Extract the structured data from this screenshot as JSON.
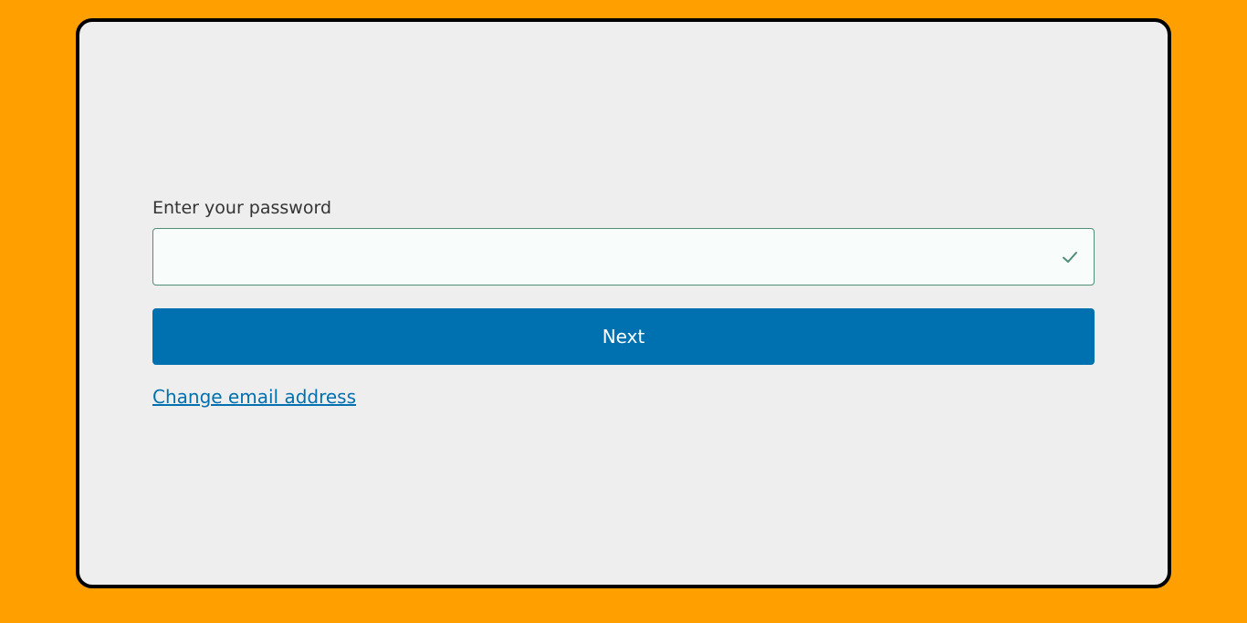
{
  "colors": {
    "page_background": "#ffa000",
    "card_background": "#eeeeee",
    "card_border": "#000000",
    "input_border_valid": "#4e8e75",
    "input_background": "#f8fcfb",
    "check_icon": "#4e8e75",
    "primary_button": "#0071b0",
    "link": "#0071b0",
    "label_text": "#333333"
  },
  "password_form": {
    "label": "Enter your password",
    "password_field": {
      "value": "",
      "placeholder": "",
      "status_icon": "check-icon"
    },
    "next_button_label": "Next",
    "change_email_link_label": "Change email address"
  }
}
